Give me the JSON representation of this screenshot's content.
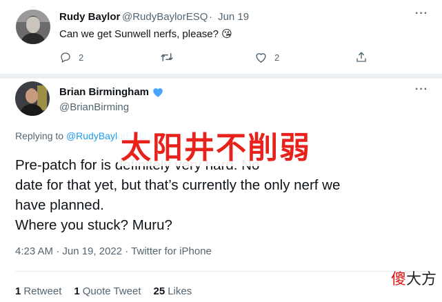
{
  "tweet1": {
    "author_name": "Rudy Baylor",
    "author_handle": "@RudyBaylorESQ",
    "separator": "·",
    "date": "Jun 19",
    "text": "Can we get Sunwell nerfs, please? 😘",
    "more": "···",
    "actions": {
      "reply_count": "2",
      "retweet_count": "",
      "like_count": "2"
    }
  },
  "tweet2": {
    "author_name": "Brian Birmingham",
    "author_handle": "@BrianBirming",
    "verified_color": "#4aa3ff",
    "more": "···",
    "replying_prefix": "Replying to",
    "replying_handles": "@RudyBaylorESQ and @dinis_paul5592",
    "body_lines": [
      "Pre-patch for          is definitely very hard.  No",
      "date for that yet, but that’s currently the only nerf we",
      "have planned.",
      "Where you stuck?  Muru?"
    ],
    "overlay_text": "太阳井不削弱",
    "timestamp": "4:23 AM · Jun 19, 2022 · Twitter for iPhone",
    "stats": {
      "retweets_num": "1",
      "retweets_label": "Retweet",
      "quotes_num": "1",
      "quotes_label": "Quote Tweet",
      "likes_num": "25",
      "likes_label": "Likes"
    }
  },
  "watermark": {
    "first_char": "傻",
    "rest": "大方"
  },
  "colors": {
    "accent": "#1d9bf0",
    "muted": "#536471",
    "overlay": "#e8221b"
  }
}
